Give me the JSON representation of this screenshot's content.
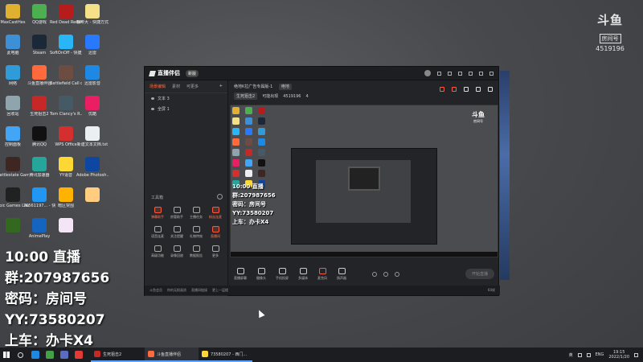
{
  "desktop": {
    "icons": [
      {
        "label": "MaxCastHes",
        "color": "#e0b030"
      },
      {
        "label": "QQ游戏",
        "color": "#4caf50"
      },
      {
        "label": "Red Dead Redempti...",
        "color": "#b71c1c"
      },
      {
        "label": "咖啡大 - 快捷方式",
        "color": "#f5e08a"
      },
      {
        "label": "此电脑",
        "color": "#3d8fd6"
      },
      {
        "label": "Steam",
        "color": "#1b2838"
      },
      {
        "label": "SoftOnOff - 快捷方式",
        "color": "#29b6f6"
      },
      {
        "label": "迅雷",
        "color": "#2979ff"
      },
      {
        "label": "网络",
        "color": "#2f9bd8"
      },
      {
        "label": "斗鱼直播伴侣",
        "color": "#ff6a3d"
      },
      {
        "label": "Battlefield Call of ...",
        "color": "#6d4c41"
      },
      {
        "label": "迅雷影音",
        "color": "#1e88e5"
      },
      {
        "label": "回收站",
        "color": "#90a4ae"
      },
      {
        "label": "生死狙击2",
        "color": "#c62828"
      },
      {
        "label": "Tom Clancy's R...",
        "color": "#455a64"
      },
      {
        "label": "优酷",
        "color": "#e91e63"
      },
      {
        "label": "控制面板",
        "color": "#42a5f5"
      },
      {
        "label": "腾讯QQ",
        "color": "#111"
      },
      {
        "label": "WPS Office",
        "color": "#d32f2f"
      },
      {
        "label": "新建文本文档.txt",
        "color": "#eceff1"
      },
      {
        "label": "Battlestate Games L...",
        "color": "#3e2723"
      },
      {
        "label": "腾讯加速器",
        "color": "#26a69a"
      },
      {
        "label": "YY语音",
        "color": "#fdd835"
      },
      {
        "label": "Adobe Photosh...",
        "color": "#0d47a1"
      },
      {
        "label": "Epic Games Launcher",
        "color": "#212121"
      },
      {
        "label": "76561197... - 快捷方式",
        "color": "#2196f3"
      },
      {
        "label": "暗区突围",
        "color": "#ffb300"
      },
      {
        "label": "",
        "color": "#ffcc80"
      },
      {
        "label": "",
        "color": "#33691e"
      },
      {
        "label": "AnimePlay",
        "color": "#1565c0"
      },
      {
        "label": "",
        "color": "#f3e5f5"
      }
    ]
  },
  "watermark": {
    "logo": "斗鱼",
    "room_label": "房间号",
    "room_id": "4519196"
  },
  "overlay": {
    "line1": "10:00 直播",
    "line2": "群:207987656",
    "line3": "密码：房间号",
    "line4": "YY:73580207",
    "line5": "上车：办卡X4"
  },
  "app": {
    "title": "直播伴侣",
    "version_pill": "新版",
    "left_tabs": [
      "场景编辑",
      "素材",
      "可更多"
    ],
    "scenes": [
      "文本 3",
      "全屏 1"
    ],
    "tools_title": "工具箱",
    "tools": [
      {
        "label": "弹幕助手",
        "hot": true
      },
      {
        "label": "房管助手",
        "hot": false
      },
      {
        "label": "主播任务",
        "hot": false
      },
      {
        "label": "粉丝连麦",
        "hot": true
      },
      {
        "label": "语音连麦",
        "hot": false
      },
      {
        "label": "关注提醒",
        "hot": false
      },
      {
        "label": "礼物特效",
        "hot": false
      },
      {
        "label": "直播间",
        "hot": true
      },
      {
        "label": "高级功能",
        "hot": false
      },
      {
        "label": "录像回放",
        "hot": false
      },
      {
        "label": "数据报告",
        "hot": false
      },
      {
        "label": "更多",
        "hot": false
      }
    ],
    "status": {
      "left1": "斗鱼会员",
      "left2": "你的无损画质",
      "left3": "直播间链接",
      "left4": "更上一层楼",
      "fps": "60帧"
    },
    "room": {
      "name": "绝地K拉广告专属版-1",
      "tag": "绝地",
      "category": "生死狙击2",
      "sub": "可能出现",
      "id": "4519196",
      "viewers": "4"
    },
    "controls": [
      "直播屏幕",
      "摄像头",
      "手机投屏",
      "多媒体",
      "麦克风",
      "扬声器"
    ],
    "golive": "开始直播",
    "preview": {
      "watermark": "斗鱼",
      "watermark_sub": "房间号",
      "overlay": [
        "10:00 直播",
        "群:207987656",
        "密码：房间号",
        "YY:73580207",
        "上车：办卡X4"
      ]
    }
  },
  "taskbar": {
    "tasks": [
      {
        "label": "生死狙击2",
        "color": "#c62828",
        "active": false
      },
      {
        "label": "斗鱼直播伴侣",
        "color": "#ff6a3d",
        "active": true
      },
      {
        "label": "73580207 - 西门... ",
        "color": "#fdd835",
        "active": false
      }
    ],
    "pinned": [
      "#1e88e5",
      "#43a047",
      "#5c6bc0",
      "#e53935"
    ],
    "lang": "ENG",
    "ime": "英",
    "time": "19:15",
    "date": "2022/1/20"
  }
}
